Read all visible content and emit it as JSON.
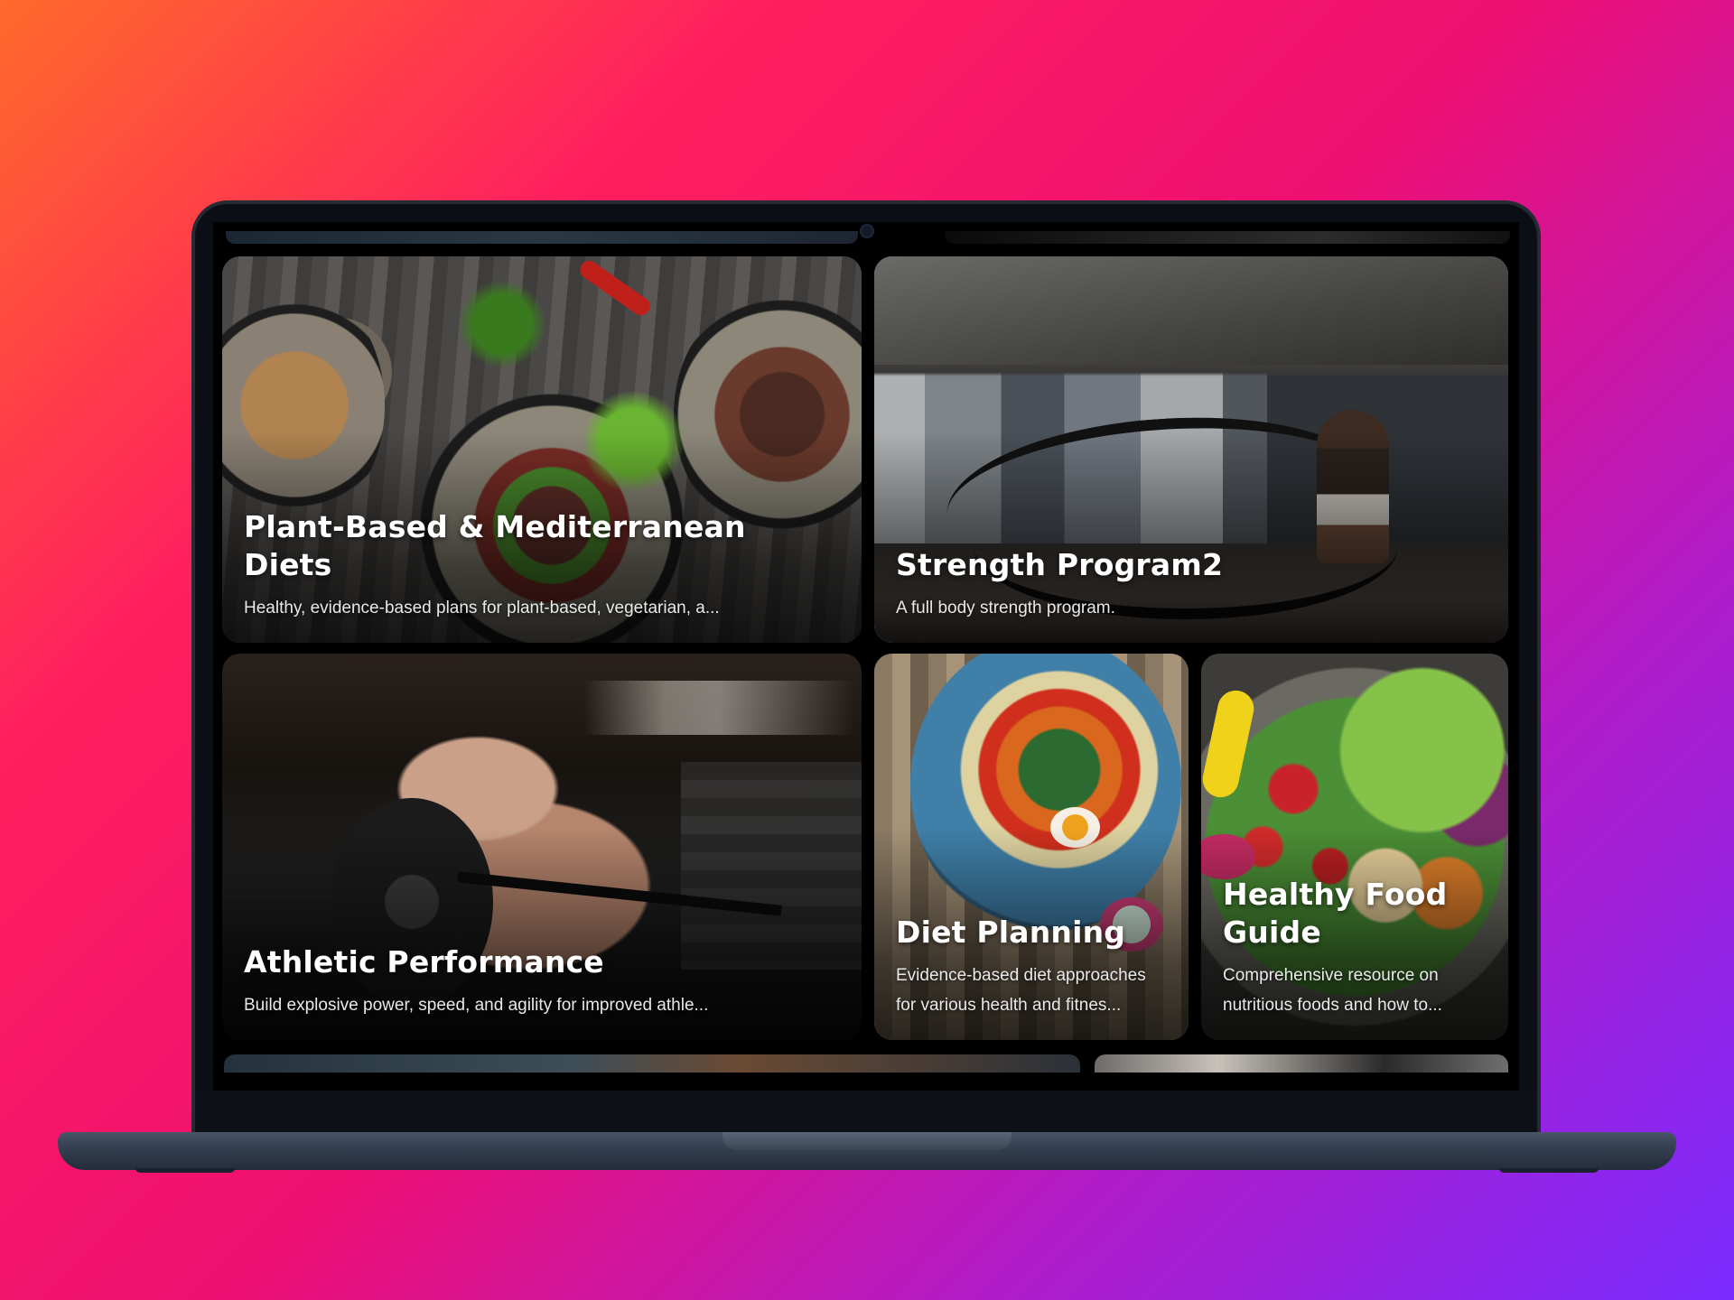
{
  "cards": [
    {
      "title": "Plant-Based & Mediterranean Diets",
      "description": "Healthy, evidence-based plans for plant-based, vegetarian, a..."
    },
    {
      "title": "Strength Program2",
      "description": "A full body strength program."
    },
    {
      "title": "Athletic Performance",
      "description": "Build explosive power, speed, and agility for improved athle..."
    },
    {
      "title": "Diet Planning",
      "description": "Evidence-based diet approaches for various health and fitnes..."
    },
    {
      "title": "Healthy Food Guide",
      "description": "Comprehensive resource on nutritious foods and how to..."
    }
  ],
  "colors": {
    "background_gradient": [
      "#ff6a2b",
      "#ff1f5e",
      "#ee0f72",
      "#b21cc8",
      "#7a2bff"
    ],
    "card_title": "#ffffff",
    "card_text": "#e9e9e9",
    "screen_bg": "#000000"
  }
}
